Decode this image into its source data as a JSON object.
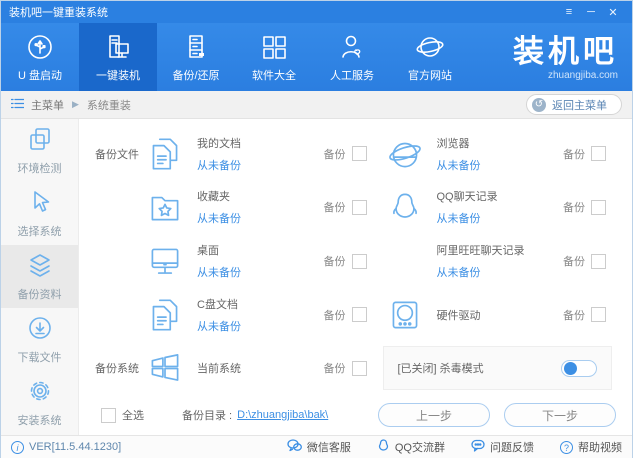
{
  "window": {
    "title": "装机吧一键重装系统"
  },
  "icons": {
    "menu": "≡",
    "minimize": "─",
    "close": "✕",
    "arrow": "▶",
    "back": "↺",
    "info": "i",
    "question": "?"
  },
  "nav": {
    "items": [
      {
        "label": "U 盘启动"
      },
      {
        "label": "一键装机"
      },
      {
        "label": "备份/还原"
      },
      {
        "label": "软件大全"
      },
      {
        "label": "人工服务"
      },
      {
        "label": "官方网站"
      }
    ],
    "logo_text": "装机吧",
    "logo_domain": "zhuangjiba.com"
  },
  "breadcrumb": {
    "root": "主菜单",
    "current": "系统重装",
    "back": "返回主菜单"
  },
  "sidebar": {
    "items": [
      {
        "label": "环境检测"
      },
      {
        "label": "选择系统"
      },
      {
        "label": "备份资料"
      },
      {
        "label": "下载文件"
      },
      {
        "label": "安装系统"
      }
    ]
  },
  "content": {
    "group_files": "备份文件",
    "group_system": "备份系统",
    "backup": "备份",
    "items": {
      "docs": {
        "title": "我的文档",
        "subtitle": "从未备份"
      },
      "browser": {
        "title": "浏览器",
        "subtitle": "从未备份"
      },
      "favorites": {
        "title": "收藏夹",
        "subtitle": "从未备份"
      },
      "qq": {
        "title": "QQ聊天记录",
        "subtitle": "从未备份"
      },
      "desktop": {
        "title": "桌面",
        "subtitle": "从未备份"
      },
      "wangwang": {
        "title": "阿里旺旺聊天记录",
        "subtitle": "从未备份"
      },
      "cdrive": {
        "title": "C盘文档",
        "subtitle": "从未备份"
      },
      "driver": {
        "title": "硬件驱动"
      },
      "system": {
        "title": "当前系统"
      }
    },
    "antivirus_label": "[已关闭] 杀毒模式",
    "antivirus_state": "off",
    "select_all": "全选",
    "dir_label": "备份目录 :",
    "dir_value": "D:\\zhuangjiba\\bak\\",
    "prev": "上一步",
    "next": "下一步"
  },
  "statusbar": {
    "version": "VER[11.5.44.1230]",
    "links": [
      {
        "label": "微信客服"
      },
      {
        "label": "QQ交流群"
      },
      {
        "label": "问题反馈"
      },
      {
        "label": "帮助视频"
      }
    ]
  }
}
